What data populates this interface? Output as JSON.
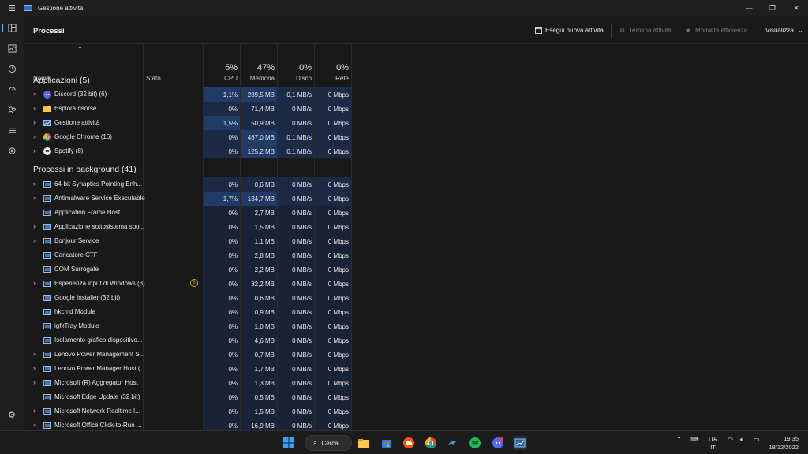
{
  "window": {
    "title": "Gestione attività",
    "controls": [
      "minimize",
      "maximize",
      "close"
    ]
  },
  "nav": {
    "items": [
      {
        "name": "processi",
        "icon": "processes-icon",
        "active": true
      },
      {
        "name": "prestazioni",
        "icon": "performance-icon"
      },
      {
        "name": "cronologia-app",
        "icon": "history-icon"
      },
      {
        "name": "app-avvio",
        "icon": "startup-icon"
      },
      {
        "name": "utenti",
        "icon": "users-icon"
      },
      {
        "name": "dettagli",
        "icon": "details-icon"
      },
      {
        "name": "servizi",
        "icon": "services-icon"
      }
    ],
    "settings_icon": "settings-icon"
  },
  "header": {
    "title": "Processi",
    "run_new_task": "Esegui nuova attività",
    "end_task": "Termina attività",
    "efficiency_mode": "Modalità efficienza",
    "view": "Visualizza"
  },
  "columns": {
    "name": "Nome",
    "status": "Stato",
    "cpu_pct": "5%",
    "cpu": "CPU",
    "mem_pct": "47%",
    "mem": "Memoria",
    "disk_pct": "0%",
    "disk": "Disco",
    "net_pct": "0%",
    "net": "Rete"
  },
  "groups": {
    "apps": "Applicazioni (5)",
    "background": "Processi in background (41)"
  },
  "apps": [
    {
      "name": "Discord (32 bit) (6)",
      "cpu": "1,1%",
      "mem": "289,5 MB",
      "disk": "0,1 MB/s",
      "net": "0 Mbps",
      "icon": "discord-icon"
    },
    {
      "name": "Esplora risorse",
      "cpu": "0%",
      "mem": "71,4 MB",
      "disk": "0 MB/s",
      "net": "0 Mbps",
      "icon": "folder-icon"
    },
    {
      "name": "Gestione attività",
      "cpu": "1,5%",
      "mem": "50,9 MB",
      "disk": "0 MB/s",
      "net": "0 Mbps",
      "icon": "task-manager-icon"
    },
    {
      "name": "Google Chrome (16)",
      "cpu": "0%",
      "mem": "487,0 MB",
      "disk": "0,1 MB/s",
      "net": "0 Mbps",
      "icon": "chrome-icon"
    },
    {
      "name": "Spotify (8)",
      "cpu": "0%",
      "mem": "125,2 MB",
      "disk": "0,1 MB/s",
      "net": "0 Mbps",
      "icon": "spotify-icon"
    }
  ],
  "background": [
    {
      "name": "64-bit Synaptics Pointing Enh...",
      "cpu": "0%",
      "mem": "0,6 MB",
      "disk": "0 MB/s",
      "net": "0 Mbps"
    },
    {
      "name": "Antimalware Service Executable",
      "cpu": "1,7%",
      "mem": "134,7 MB",
      "disk": "0 MB/s",
      "net": "0 Mbps"
    },
    {
      "name": "Application Frame Host",
      "cpu": "0%",
      "mem": "2,7 MB",
      "disk": "0 MB/s",
      "net": "0 Mbps"
    },
    {
      "name": "Applicazione sottosistema spo...",
      "cpu": "0%",
      "mem": "1,5 MB",
      "disk": "0 MB/s",
      "net": "0 Mbps"
    },
    {
      "name": "Bonjour Service",
      "cpu": "0%",
      "mem": "1,1 MB",
      "disk": "0 MB/s",
      "net": "0 Mbps"
    },
    {
      "name": "Caricatore CTF",
      "cpu": "0%",
      "mem": "2,8 MB",
      "disk": "0 MB/s",
      "net": "0 Mbps"
    },
    {
      "name": "COM Surrogate",
      "cpu": "0%",
      "mem": "2,2 MB",
      "disk": "0 MB/s",
      "net": "0 Mbps"
    },
    {
      "name": "Esperienza input di Windows (3)",
      "cpu": "0%",
      "mem": "32,2 MB",
      "disk": "0 MB/s",
      "net": "0 Mbps"
    },
    {
      "name": "Google Installer (32 bit)",
      "cpu": "0%",
      "mem": "0,6 MB",
      "disk": "0 MB/s",
      "net": "0 Mbps"
    },
    {
      "name": "hkcmd Module",
      "cpu": "0%",
      "mem": "0,9 MB",
      "disk": "0 MB/s",
      "net": "0 Mbps"
    },
    {
      "name": "igfxTray Module",
      "cpu": "0%",
      "mem": "1,0 MB",
      "disk": "0 MB/s",
      "net": "0 Mbps"
    },
    {
      "name": "Isolamento grafico dispositivo...",
      "cpu": "0%",
      "mem": "4,6 MB",
      "disk": "0 MB/s",
      "net": "0 Mbps"
    },
    {
      "name": "Lenovo Power Management S...",
      "cpu": "0%",
      "mem": "0,7 MB",
      "disk": "0 MB/s",
      "net": "0 Mbps"
    },
    {
      "name": "Lenovo Power Manager Host (...",
      "cpu": "0%",
      "mem": "1,7 MB",
      "disk": "0 MB/s",
      "net": "0 Mbps"
    },
    {
      "name": "Microsoft (R) Aggregator Host",
      "cpu": "0%",
      "mem": "1,3 MB",
      "disk": "0 MB/s",
      "net": "0 Mbps"
    },
    {
      "name": "Microsoft Edge Update (32 bit)",
      "cpu": "0%",
      "mem": "0,5 MB",
      "disk": "0 MB/s",
      "net": "0 Mbps"
    },
    {
      "name": "Microsoft Network Realtime I...",
      "cpu": "0%",
      "mem": "1,5 MB",
      "disk": "0 MB/s",
      "net": "0 Mbps"
    },
    {
      "name": "Microsoft Office Click-to-Run ...",
      "cpu": "0%",
      "mem": "16,9 MB",
      "disk": "0 MB/s",
      "net": "0 Mbps"
    }
  ],
  "taskbar": {
    "search": "Cerca",
    "lang_top": "ITA",
    "lang_bottom": "IT",
    "time": "19:35",
    "date": "18/12/2022"
  },
  "colors": {
    "accent": "#6fb1ff",
    "heat_high": "#213a66",
    "heat_mid": "#1c2a45",
    "heat_low": "#1a2236",
    "paused": "#d1a400"
  }
}
